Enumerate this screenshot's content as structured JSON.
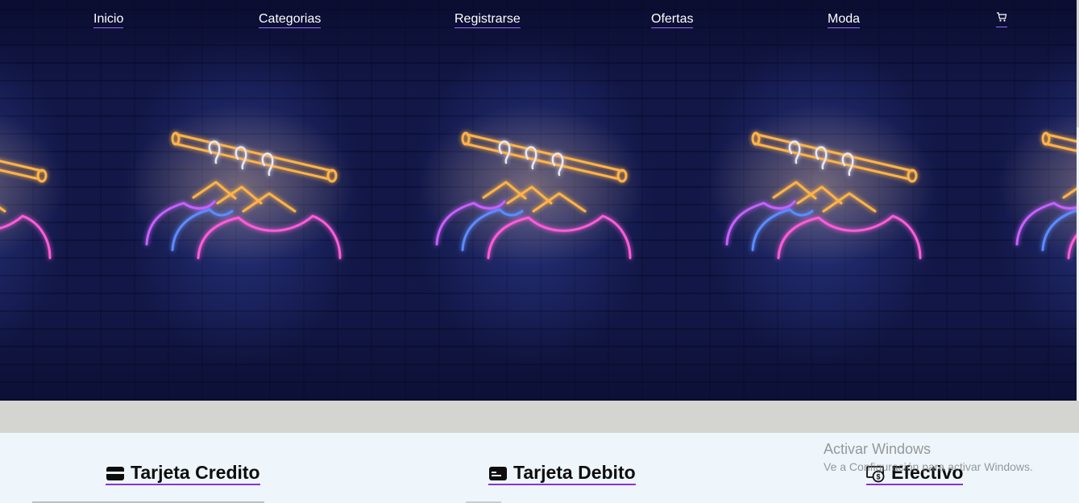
{
  "nav": {
    "items": [
      "Inicio",
      "Categorias",
      "Registrarse",
      "Ofertas",
      "Moda"
    ],
    "cart_icon": "cart-icon"
  },
  "hero": {
    "image": "neon-clothes-hangers-on-brick-wall"
  },
  "payment": {
    "methods": [
      {
        "label": "Tarjeta Credito",
        "icon": "credit-card-icon"
      },
      {
        "label": "Tarjeta Debito",
        "icon": "debit-card-icon"
      },
      {
        "label": "Efectivo",
        "icon": "cash-icon"
      }
    ]
  },
  "watermark": {
    "title": "Activar Windows",
    "subtitle": "Ve a Configuración para activar Windows."
  },
  "colors": {
    "accent_underline": "#8a2fe0",
    "hero_wall": "#1c2566",
    "band": "#d4d5d0",
    "section_bg": "#eef6fc"
  }
}
